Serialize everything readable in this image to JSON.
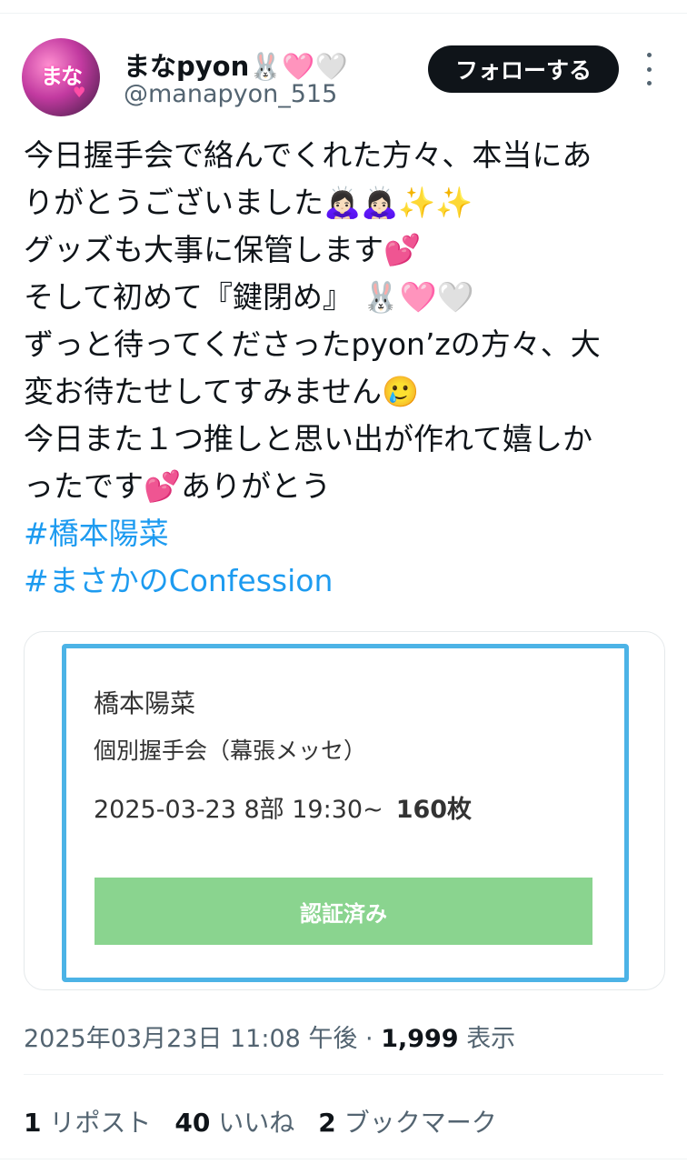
{
  "author": {
    "display_name": "まなpyon",
    "handle": "@manapyon_515",
    "name_emojis": [
      "🐰",
      "🩷",
      "🤍"
    ],
    "avatar_text": "まな"
  },
  "follow_label": "フォローする",
  "tweet": {
    "lines": [
      "今日握手会で絡んでくれた方々、本当にあ",
      "りがとうございました",
      "グッズも大事に保管します",
      "そして初めて『鍵閉め』",
      "ずっと待ってくださったpyon’zの方々、大",
      "変お待たせしてすみません",
      "今日また１つ推しと思い出が作れて嬉しか",
      "ったです",
      "ありがとう"
    ],
    "emoji": {
      "thanks": "🙇🏻‍♀️🙇🏻‍♀️✨✨",
      "heart": "💕",
      "bunny_hearts": "🐰🩷🤍",
      "tears": "🥲"
    },
    "hashtags": [
      "#橋本陽菜",
      "#まさかのConfession"
    ]
  },
  "ticket": {
    "name": "橋本陽菜",
    "event": "個別握手会（幕張メッセ）",
    "date_slot": "2025-03-23  8部  19:30~",
    "count": "160枚",
    "status_label": "認証済み"
  },
  "meta": {
    "timestamp": "2025年03月23日 11:08 午後",
    "separator": "·",
    "views_count": "1,999",
    "views_label": "表示"
  },
  "stats": {
    "reposts_count": "1",
    "reposts_label": "リポスト",
    "likes_count": "40",
    "likes_label": "いいね",
    "bookmarks_count": "2",
    "bookmarks_label": "ブックマーク"
  },
  "colors": {
    "text": "#0f1419",
    "secondary": "#536471",
    "link": "#1d9bf0",
    "ticket_border": "#4cb3e6",
    "verified_bg": "#8ad48f"
  }
}
